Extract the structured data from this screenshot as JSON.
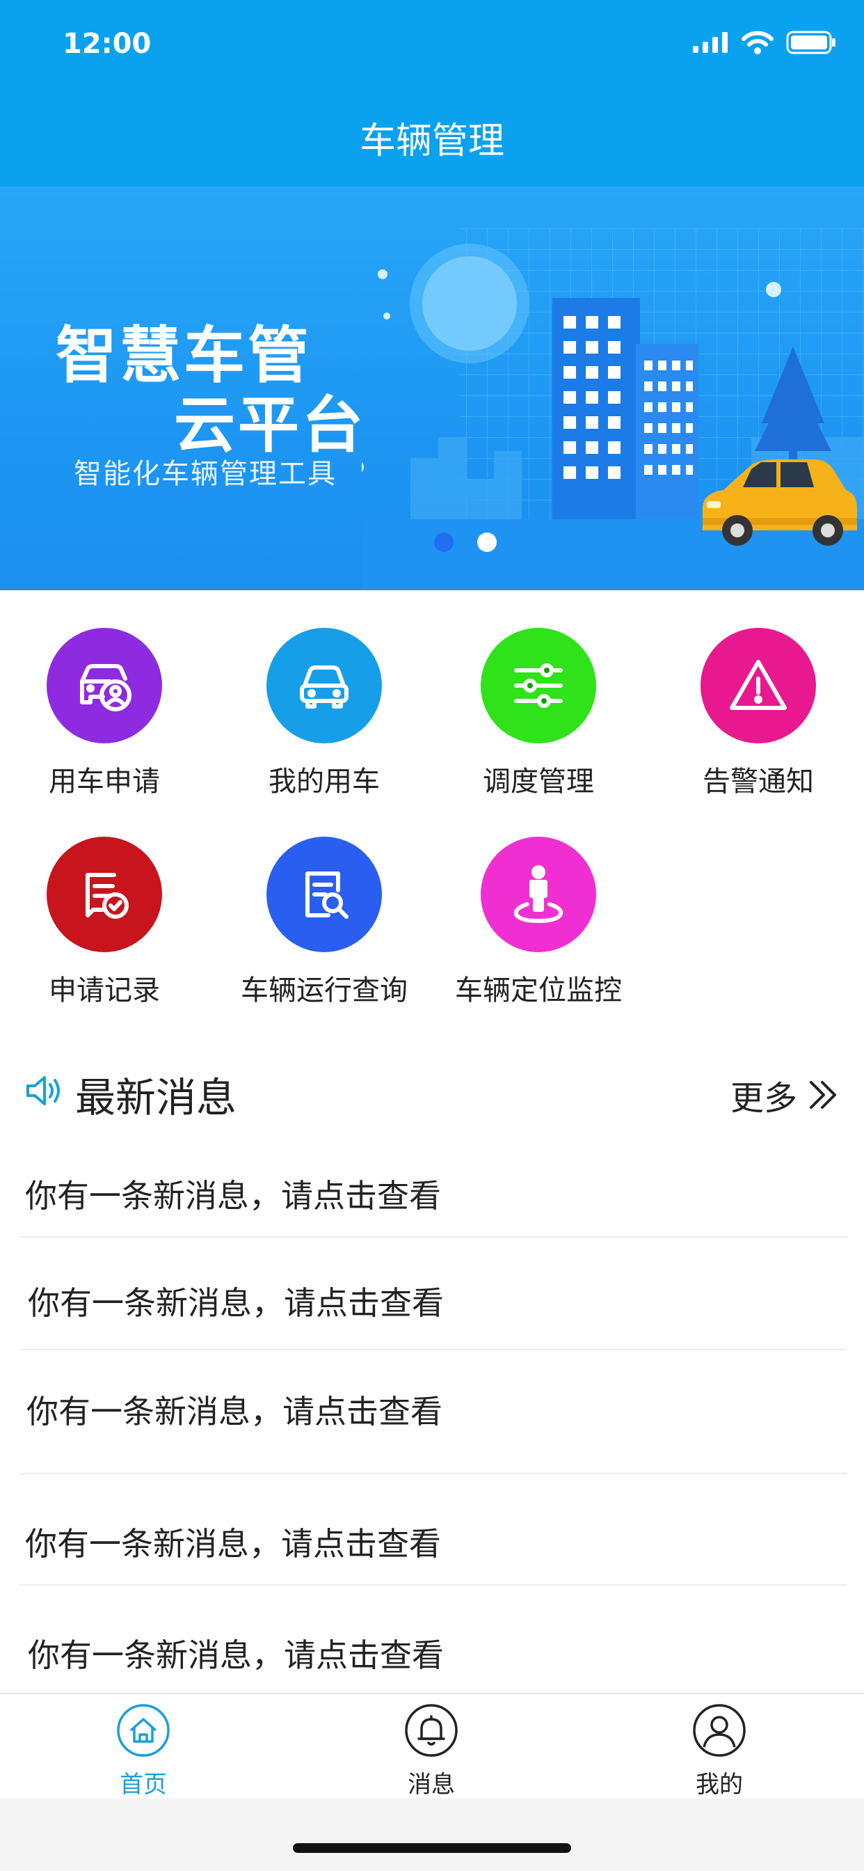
{
  "status_bar": {
    "time": "12:00"
  },
  "header": {
    "title": "车辆管理"
  },
  "banner": {
    "title_line1": "智慧车管",
    "title_line2": "云平台",
    "subtitle": "智能化车辆管理工具",
    "active_slide": 1,
    "slide_count": 2
  },
  "menu": [
    {
      "label": "用车申请",
      "icon": "car-user-icon",
      "color": "#8e2be0"
    },
    {
      "label": "我的用车",
      "icon": "car-icon",
      "color": "#169ee8"
    },
    {
      "label": "调度管理",
      "icon": "sliders-icon",
      "color": "#2fe21a"
    },
    {
      "label": "告警通知",
      "icon": "warning-icon",
      "color": "#e8188f"
    },
    {
      "label": "申请记录",
      "icon": "document-check-icon",
      "color": "#c8141d"
    },
    {
      "label": "车辆运行查询",
      "icon": "document-search-icon",
      "color": "#2a5ef0"
    },
    {
      "label": "车辆定位监控",
      "icon": "location-person-icon",
      "color": "#f02fd2"
    }
  ],
  "news": {
    "title": "最新消息",
    "more_label": "更多",
    "items": [
      "你有一条新消息，请点击查看",
      "你有一条新消息，请点击查看",
      "你有一条新消息，请点击查看",
      "你有一条新消息，请点击查看",
      "你有一条新消息，请点击查看"
    ]
  },
  "tabbar": {
    "items": [
      {
        "label": "首页",
        "icon": "home-icon",
        "active": true
      },
      {
        "label": "消息",
        "icon": "bell-icon",
        "active": false
      },
      {
        "label": "我的",
        "icon": "user-icon",
        "active": false
      }
    ],
    "active_color": "#1a9fd6",
    "inactive_color": "#222222"
  },
  "colors": {
    "header_bg": "#0aa1ee",
    "accent": "#1a9fd6"
  }
}
